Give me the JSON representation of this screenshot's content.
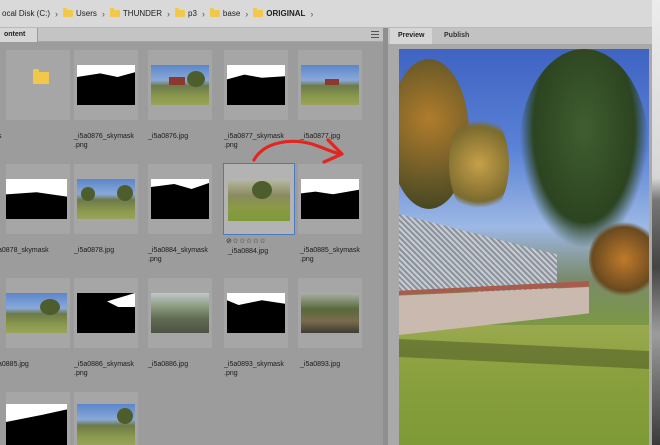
{
  "breadcrumb": [
    {
      "label": "ocal Disk (C:)",
      "icon": "none"
    },
    {
      "label": "Users",
      "icon": "folder-icon"
    },
    {
      "label": "THUNDER",
      "icon": "folder-icon"
    },
    {
      "label": "p3",
      "icon": "folder-icon"
    },
    {
      "label": "base",
      "icon": "folder-icon"
    },
    {
      "label": "ORIGINAL",
      "icon": "folder-icon"
    }
  ],
  "content_panel": {
    "tab_label": "ontent",
    "menu_icon": "panel-menu-icon",
    "items": [
      {
        "kind": "folder",
        "label": "s"
      },
      {
        "kind": "mask",
        "label": "_i5a0876_skymask\n.png"
      },
      {
        "kind": "photo",
        "label": "_i5a0876.jpg"
      },
      {
        "kind": "mask",
        "label": "_i5a0877_skymask\n.png"
      },
      {
        "kind": "photo",
        "label": "_i5a0877.jpg"
      },
      {
        "kind": "mask",
        "label": "a0878_skymask"
      },
      {
        "kind": "photo",
        "label": "_i5a0878.jpg"
      },
      {
        "kind": "mask",
        "label": "_i5a0884_skymask\n.png"
      },
      {
        "kind": "photo",
        "label": "_i5a0884.jpg",
        "selected": true,
        "rating_icon": "reject-icon",
        "stars": "☆☆☆☆☆"
      },
      {
        "kind": "mask",
        "label": "_i5a0885_skymask\n.png"
      },
      {
        "kind": "photo",
        "label": "a0885.jpg"
      },
      {
        "kind": "mask",
        "label": "_i5a0886_skymask\n.png"
      },
      {
        "kind": "pergola",
        "label": "_i5a0886.jpg"
      },
      {
        "kind": "mask",
        "label": "_i5a0893_skymask\n.png"
      },
      {
        "kind": "rock",
        "label": "_i5a0893.jpg"
      },
      {
        "kind": "mask",
        "label": ""
      },
      {
        "kind": "photo",
        "label": ""
      }
    ]
  },
  "preview_panel": {
    "tabs": [
      {
        "label": "Preview",
        "active": true
      },
      {
        "label": "Publish",
        "active": false
      }
    ],
    "image_icon": "preview-image"
  },
  "annotation": {
    "color": "#e0261f",
    "icon": "red-arrow-annotation"
  }
}
